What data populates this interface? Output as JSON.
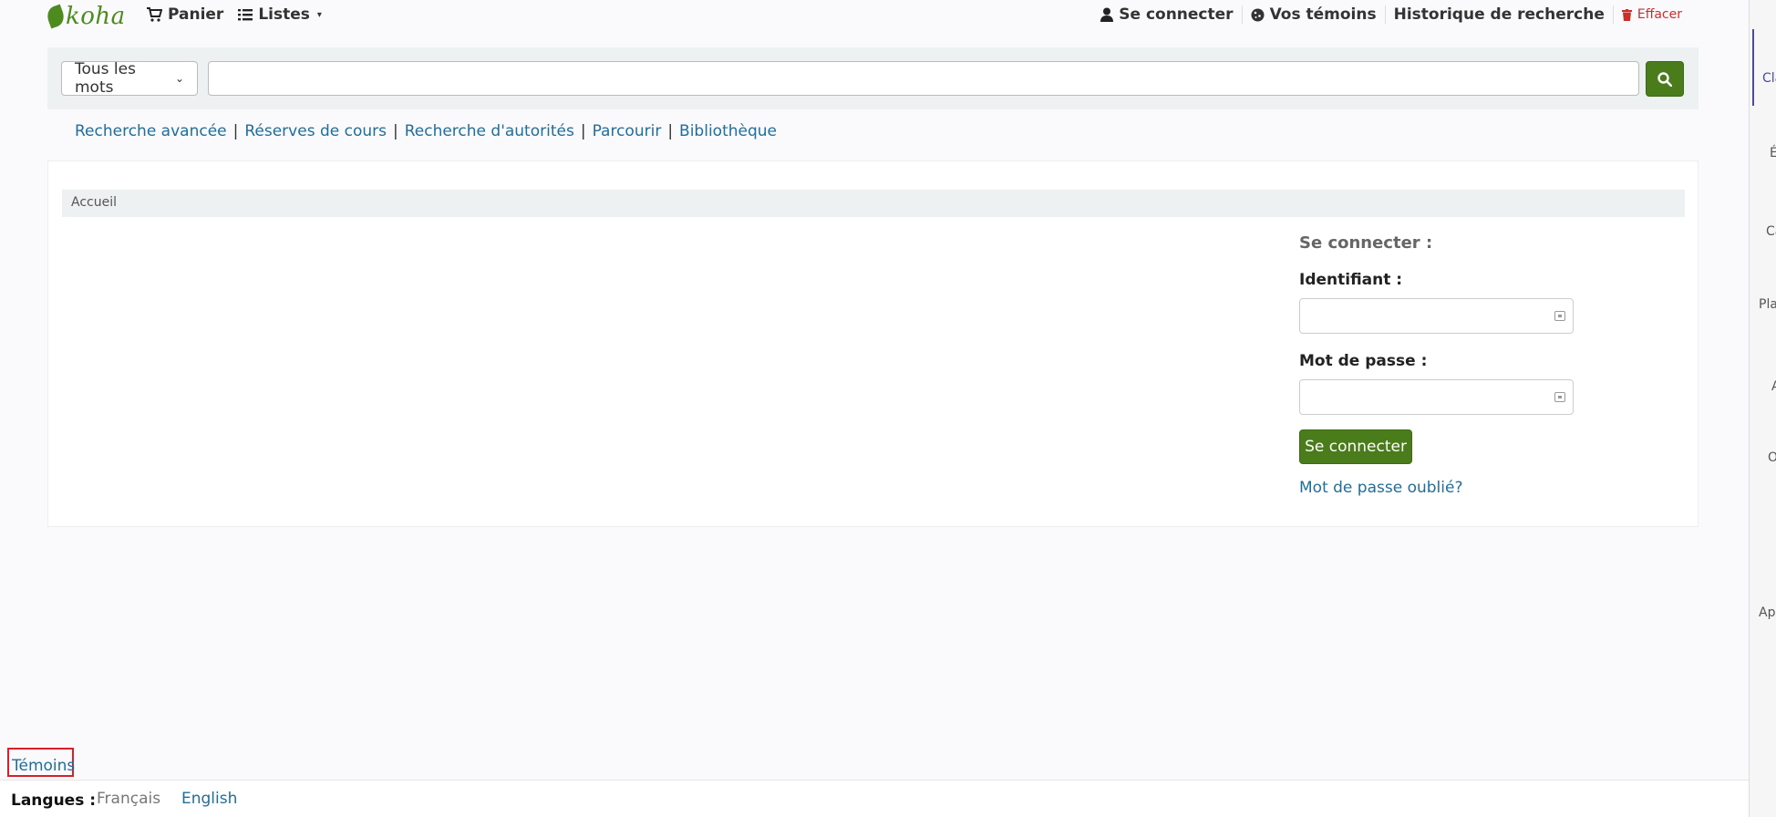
{
  "topbar": {
    "brand": "koha",
    "cart_label": "Panier",
    "lists_label": "Listes",
    "login_label": "Se connecter",
    "cookies_label": "Vos témoins",
    "history_label": "Historique de recherche",
    "clear_label": "Effacer"
  },
  "search": {
    "scope_selected": "Tous les mots",
    "query_value": "",
    "query_placeholder": ""
  },
  "links": [
    "Recherche avancée",
    "Réserves de cours",
    "Recherche d'autorités",
    "Parcourir",
    "Bibliothèque"
  ],
  "breadcrumb": "Accueil",
  "login": {
    "title": "Se connecter :",
    "userid_label": "Identifiant :",
    "password_label": "Mot de passe :",
    "submit_label": "Se connecter",
    "forgot_label": "Mot de passe oublié?"
  },
  "right_strip": {
    "tabs": [
      "Cla",
      "É",
      "Ca",
      "Pla",
      "A",
      "O",
      "App"
    ]
  },
  "footer": {
    "cookies_link": "Témoins",
    "languages_label": "Langues :",
    "current_language": "Français",
    "other_language": "English"
  },
  "colors": {
    "brand_green": "#4a7c1b",
    "link_blue": "#1f6e9c",
    "danger_red": "#c9302c"
  },
  "icons": {
    "cart": "cart-icon",
    "lists": "list-icon",
    "user": "user-icon",
    "cookie": "cookie-icon",
    "trash": "trash-icon",
    "search": "search-icon",
    "key": "key-icon"
  }
}
